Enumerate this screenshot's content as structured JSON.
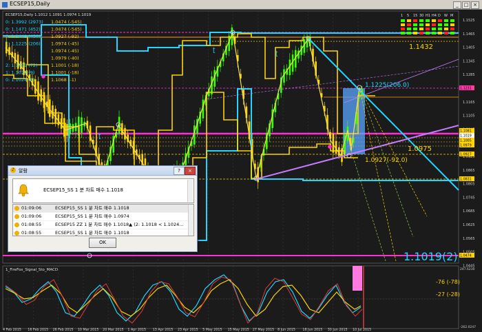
{
  "window": {
    "title": "ECSEP15,Daily",
    "header_text": "ECSEP15,Daily  1.1012 1.1091 1.0974 1.1019"
  },
  "timeframes": [
    "1",
    "5",
    "15",
    "30",
    "H1",
    "H4",
    "D",
    "W",
    "M"
  ],
  "left_levels": [
    {
      "a": "0: 1.3992 (2973)",
      "b": "1.0474 (-545)"
    },
    {
      "a": "0: 1.1471 (452)",
      "b": "1.0474 (-545)"
    },
    {
      "a": "0: 1.1449 (430)",
      "b": "1.0927 (-92)"
    },
    {
      "a": "1: 1.1225 (206)",
      "b": "1.0974 (-45)"
    },
    {
      "a": "",
      "b": "1.0974 (-45)"
    },
    {
      "a": "",
      "b": "1.0979 (-40)"
    },
    {
      "a": "2: 1.1091 (72)",
      "b": "1.1001 (-18)"
    },
    {
      "a": "1: 1.1028 (9)",
      "b": "1.1001 (-18)"
    },
    {
      "a": "0: 1.1024 (5)",
      "b": "1.1068 (-1)"
    }
  ],
  "price_axis": [
    "1.1525",
    "1.1465",
    "1.1405",
    "1.1345",
    "1.1285",
    "1.1225",
    "1.1165",
    "1.1105",
    "1.1045",
    "1.0985",
    "1.0925",
    "1.0865",
    "1.0805",
    "1.0745",
    "1.0685",
    "1.0625",
    "1.0565",
    "1.0505",
    "1.0445"
  ],
  "price_tags": [
    {
      "text": "1.1231",
      "color": "#ff3aa6"
    },
    {
      "text": "1.1081",
      "color": "#ffd400"
    },
    {
      "text": "1.1051",
      "color": "#ffd400"
    },
    {
      "text": "1.1019",
      "color": "#ffffff"
    },
    {
      "text": "1.1005",
      "color": "#ffd400"
    },
    {
      "text": "1.0979",
      "color": "#ffd400"
    },
    {
      "text": "1.0927",
      "color": "#ffd400"
    },
    {
      "text": "1.0831",
      "color": "#ffd400"
    },
    {
      "text": "1.0474",
      "color": "#ffd400"
    }
  ],
  "annotations": {
    "a1": "1.1432",
    "a2": "1.1225(206.0)",
    "a3": "1.0975",
    "a4": "1.0927(-92.0)",
    "a5": "1.1019(2)"
  },
  "sub_indicator": {
    "name": "1_FireFox_Signal_Sto_MACD",
    "v1": "-76  (-78)",
    "v2": "-27  (-28)",
    "axis_top": "247.6230",
    "axis_bottom": "-262.0247"
  },
  "dates": [
    "4 Feb 2015",
    "16 Feb 2015",
    "26 Feb 2015",
    "10 Mar 2015",
    "20 Mar 2015",
    "1 Apr 2015",
    "13 Apr 2015",
    "23 Apr 2015",
    "5 May 2015",
    "15 May 2015",
    "27 May 2015",
    "8 Jun 2015",
    "18 Jun 2015",
    "30 Jun 2015",
    "10 Jul 2015"
  ],
  "dialog": {
    "title": "알람",
    "message": "ECSEP15_SS  1 분 차트  매수 1.1018",
    "rows": [
      {
        "time": "01:09:06",
        "msg": "ECSEP15_SS  1 분 차트  매수 1.1018"
      },
      {
        "time": "01:09:06",
        "msg": "ECSEP15_SS  1 분 차트  매수 1.0974"
      },
      {
        "time": "01:08:55",
        "msg": "ECSEP15 ZZ  1 분 차트  매수  1.1018▲  (2: 1.1018 < 1.1024..."
      },
      {
        "time": "01:08:55",
        "msg": "ECSEP15_SS  1 분 차트  매수 1.1018"
      }
    ],
    "ok_label": "OK"
  },
  "colors": {
    "candle_up": "#36ff00",
    "candle_down": "#ffd400",
    "cyan": "#22d6ff",
    "magenta": "#ff2fd6",
    "purple": "#c77bff",
    "orange": "#ff9a1e"
  }
}
